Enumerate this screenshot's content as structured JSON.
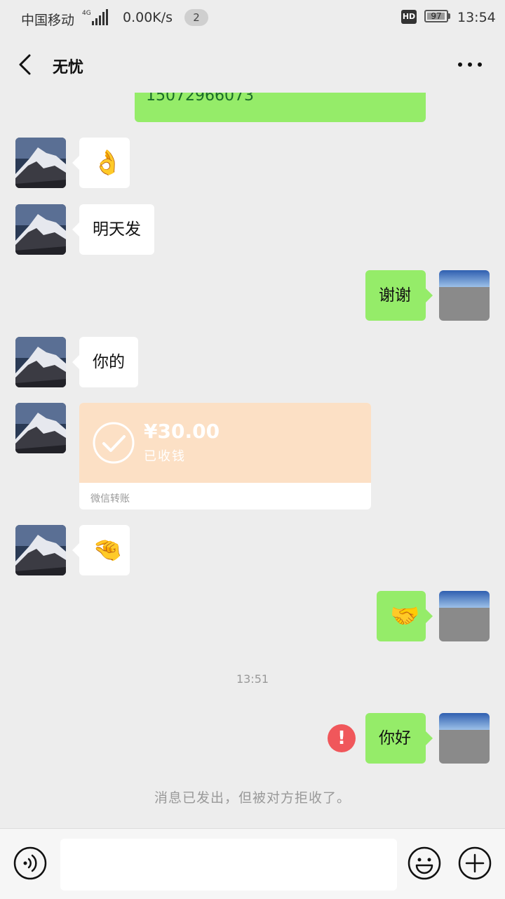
{
  "status_bar": {
    "carrier": "中国移动",
    "network_type": "4G",
    "speed": "0.00K/s",
    "notification_count": "2",
    "hd_label": "HD",
    "battery_level": "97",
    "time": "13:54"
  },
  "nav": {
    "title": "无忧",
    "back_icon": "chevron-left-icon",
    "more_icon": "more-dots-icon"
  },
  "messages": {
    "partial_phone": "15072966073",
    "msg_ok_emoji": "👌",
    "msg_tomorrow": "明天发",
    "msg_thanks": "谢谢",
    "msg_yours": "你的",
    "transfer": {
      "amount": "¥30.00",
      "status": "已收钱",
      "label": "微信转账"
    },
    "msg_pinch_emoji": "🤏",
    "msg_handshake_emoji": "🤝",
    "timestamp": "13:51",
    "msg_hello": "你好",
    "error_symbol": "!",
    "system_note": "消息已发出，但被对方拒收了。"
  },
  "colors": {
    "background": "#EDEDED",
    "incoming_bubble": "#FFFFFF",
    "outgoing_bubble": "#95EC69",
    "transfer_card": "#FCE0C5",
    "error": "#F0575B"
  },
  "input_bar": {
    "voice_icon": "voice-icon",
    "emoji_icon": "emoji-icon",
    "plus_icon": "plus-icon"
  }
}
